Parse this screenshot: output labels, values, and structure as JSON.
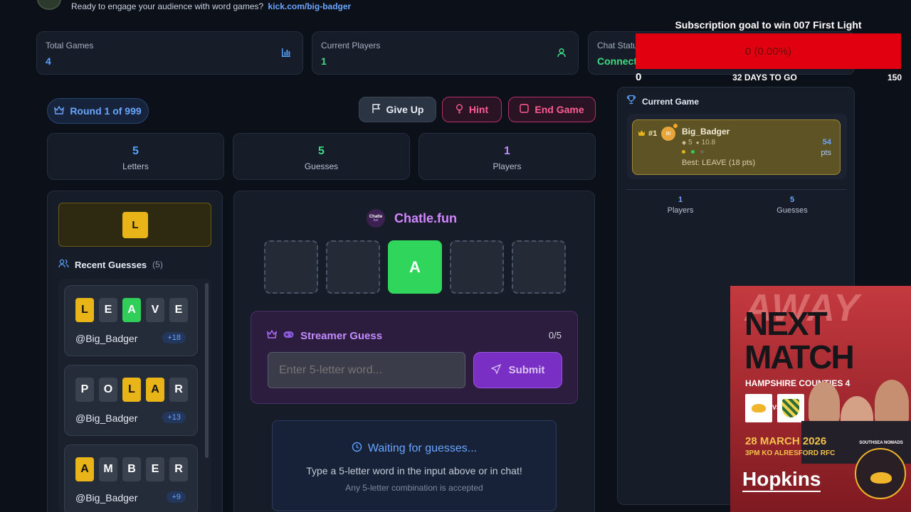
{
  "header": {
    "tagline": "Ready to engage your audience with word games?",
    "link": "kick.com/big-badger"
  },
  "stats": [
    {
      "label": "Total Games",
      "value": "4",
      "icon": "chart-icon",
      "color": "#5aa0ff"
    },
    {
      "label": "Current Players",
      "value": "1",
      "icon": "user-icon",
      "color": "#3ddc84"
    },
    {
      "label": "Chat Status",
      "value": "Connected",
      "icon": "chat-icon",
      "color": "#3ddc84"
    }
  ],
  "round": {
    "label": "Round 1 of 999"
  },
  "actions": {
    "give_up": "Give Up",
    "hint": "Hint",
    "end_game": "End Game"
  },
  "info": [
    {
      "value": "5",
      "label": "Letters",
      "color": "#5aa0ff"
    },
    {
      "value": "5",
      "label": "Guesses",
      "color": "#3ddc84"
    },
    {
      "value": "1",
      "label": "Players",
      "color": "#b98cff"
    }
  ],
  "known_letter": "L",
  "recent": {
    "title": "Recent Guesses",
    "count": "(5)",
    "items": [
      {
        "letters": [
          "L",
          "E",
          "A",
          "V",
          "E"
        ],
        "states": [
          "yellow",
          "gray",
          "green",
          "gray",
          "gray"
        ],
        "user": "@Big_Badger",
        "points": "+18"
      },
      {
        "letters": [
          "P",
          "O",
          "L",
          "A",
          "R"
        ],
        "states": [
          "gray",
          "gray",
          "yellow",
          "yellow",
          "gray"
        ],
        "user": "@Big_Badger",
        "points": "+13"
      },
      {
        "letters": [
          "A",
          "M",
          "B",
          "E",
          "R"
        ],
        "states": [
          "yellow",
          "gray",
          "gray",
          "gray",
          "gray"
        ],
        "user": "@Big_Badger",
        "points": "+9"
      }
    ]
  },
  "board": {
    "logo_text": "Chatle",
    "logo_sub": "fun",
    "brand": "Chatle.fun",
    "slots": [
      "",
      "",
      "A",
      "",
      ""
    ]
  },
  "streamer": {
    "title": "Streamer Guess",
    "counter": "0/5",
    "placeholder": "Enter 5-letter word...",
    "submit": "Submit"
  },
  "waiting": {
    "title": "Waiting for guesses...",
    "line1": "Type a 5-letter word in the input above or in chat!",
    "line2": "Any 5-letter combination is accepted"
  },
  "current_game": {
    "title": "Current Game",
    "player": {
      "rank": "#1",
      "avatar": "BI",
      "name": "Big_Badger",
      "meta1": "5",
      "meta2": "10.8",
      "points": "54",
      "points_label": "pts",
      "best": "Best: LEAVE (18 pts)"
    },
    "stats": [
      {
        "value": "1",
        "label": "Players"
      },
      {
        "value": "5",
        "label": "Guesses"
      }
    ]
  },
  "sub_goal": {
    "title": "Subscription goal to win 007 First Light",
    "progress_text": "0 (0.00%)",
    "progress": 0.0,
    "min": "0",
    "days": "32 DAYS TO GO",
    "max": "150",
    "color": "#e00010"
  },
  "promo": {
    "bg_word": "AWAY",
    "line1": "NEXT",
    "line2": "MATCH",
    "league": "HAMPSHIRE COUNTIES 4",
    "vs": "VS",
    "date": "28 MARCH 2026",
    "time_venue": "3PM KO  ALRESFORD RFC",
    "club": "SOUTHSEA NOMADS",
    "sponsor": "Hopkins"
  }
}
